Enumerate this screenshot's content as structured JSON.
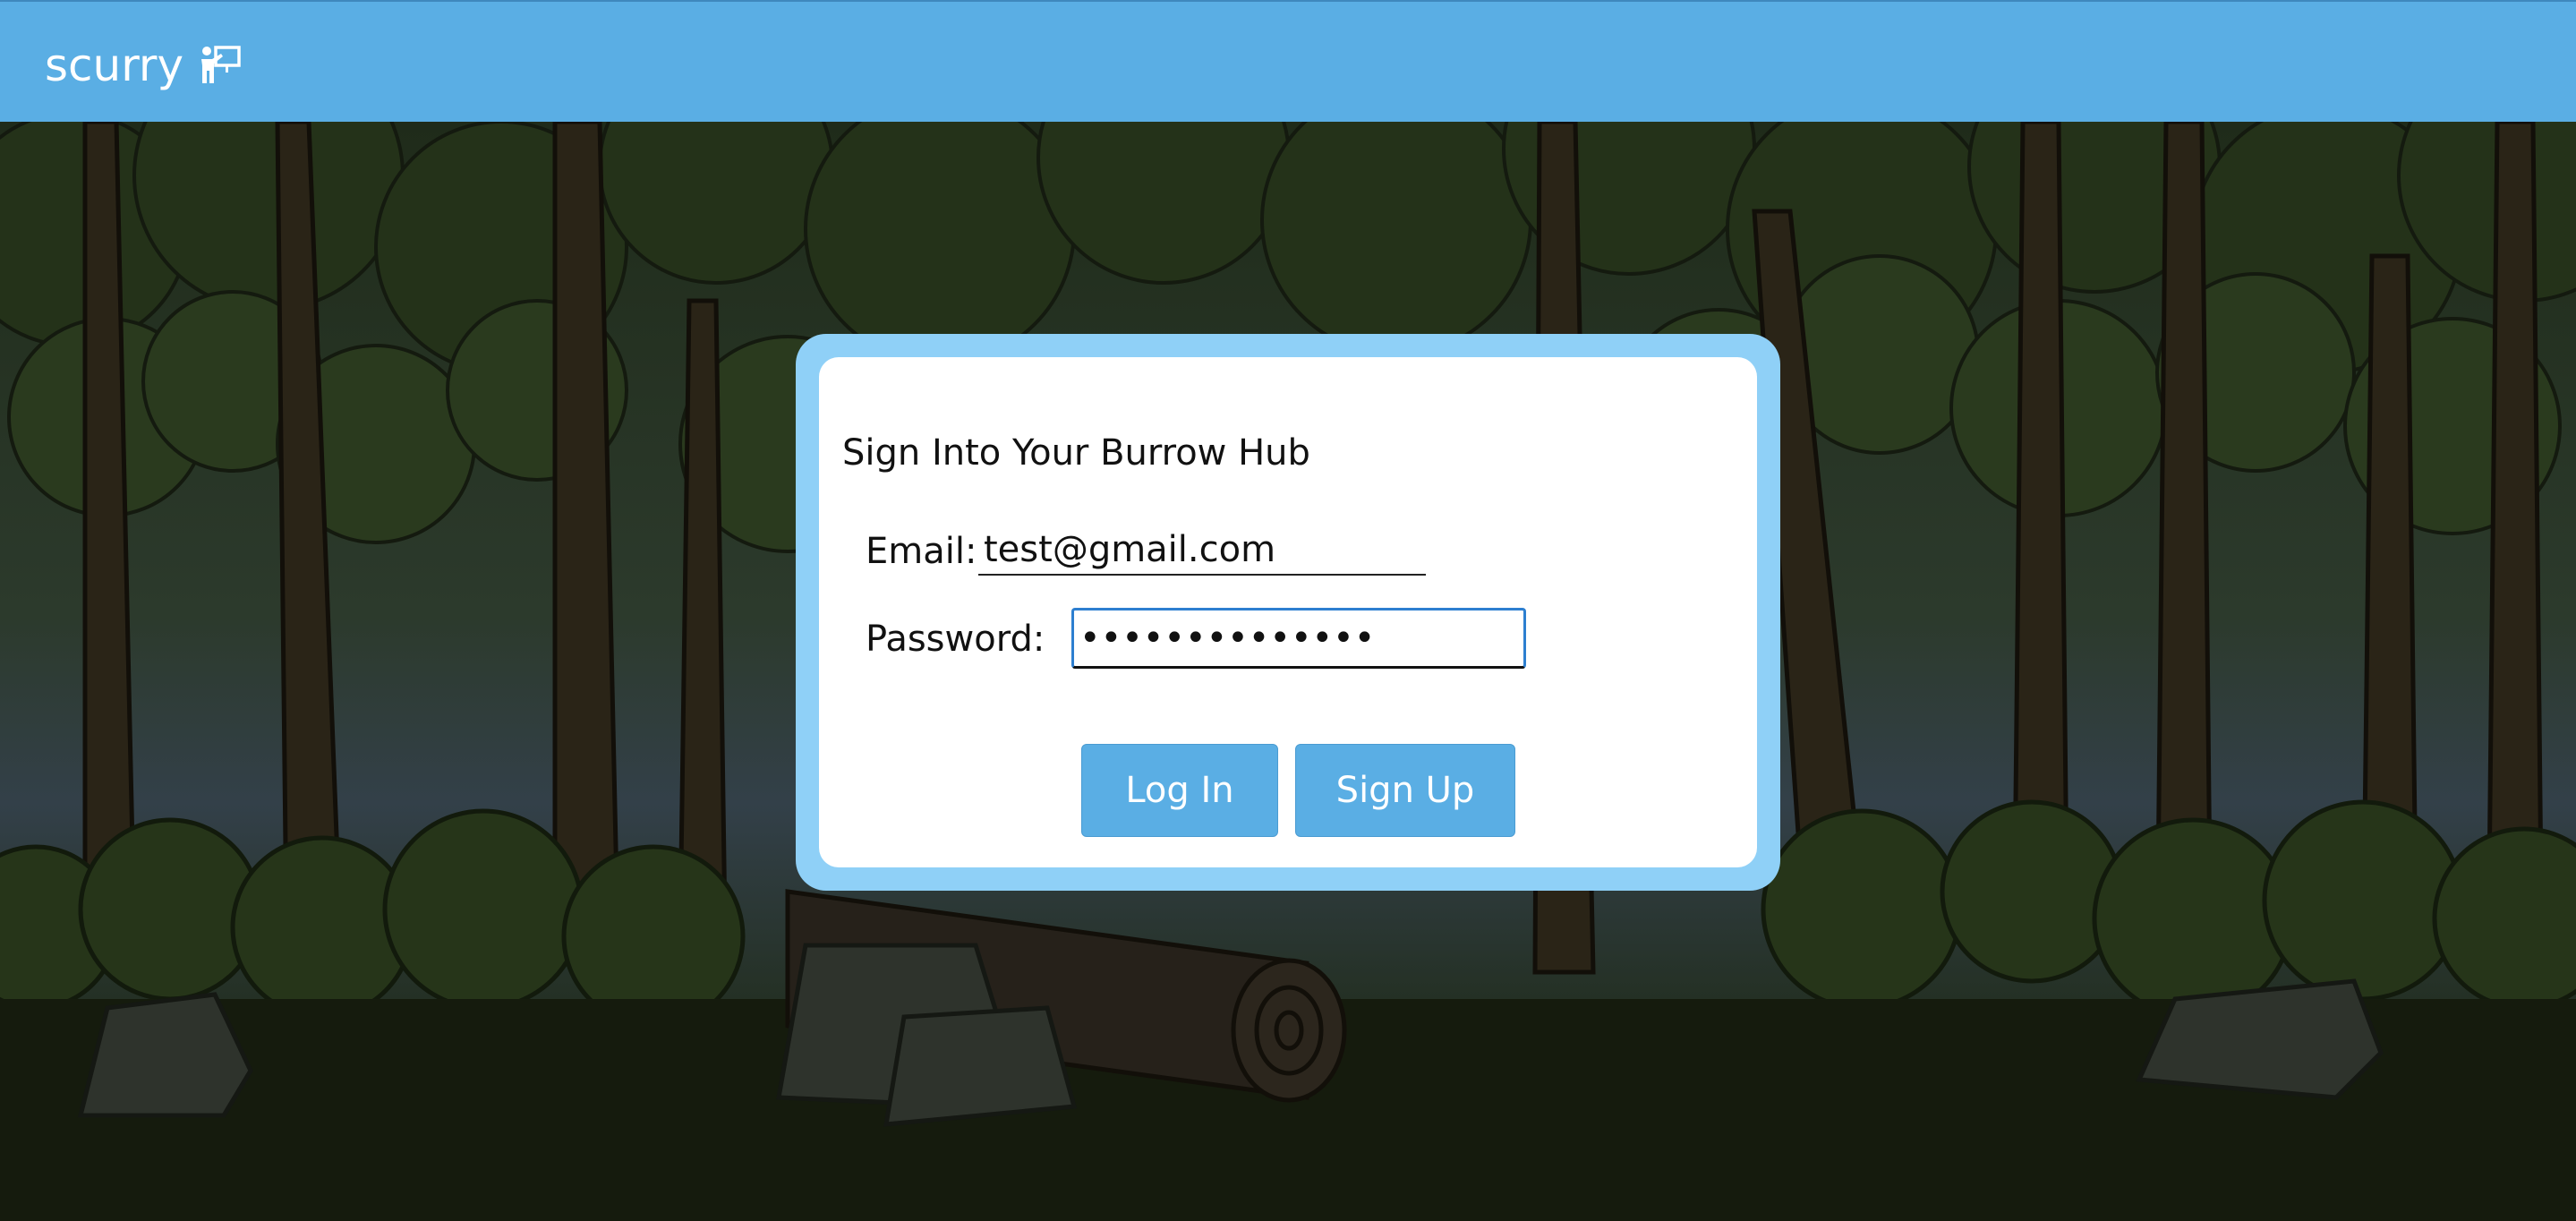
{
  "app": {
    "brand_name": "scurry",
    "brand_icon": "presenter-board-icon"
  },
  "login": {
    "title": "Sign Into Your Burrow Hub",
    "email_label": "Email:",
    "email_value": "test@gmail.com",
    "password_label": "Password:",
    "password_value": "••••••••••••••",
    "login_button": "Log In",
    "signup_button": "Sign Up"
  },
  "colors": {
    "topbar": "#5aaee4",
    "card_border": "#8fd0f7",
    "button": "#5aaee4",
    "focus_border": "#2d7fd0"
  }
}
